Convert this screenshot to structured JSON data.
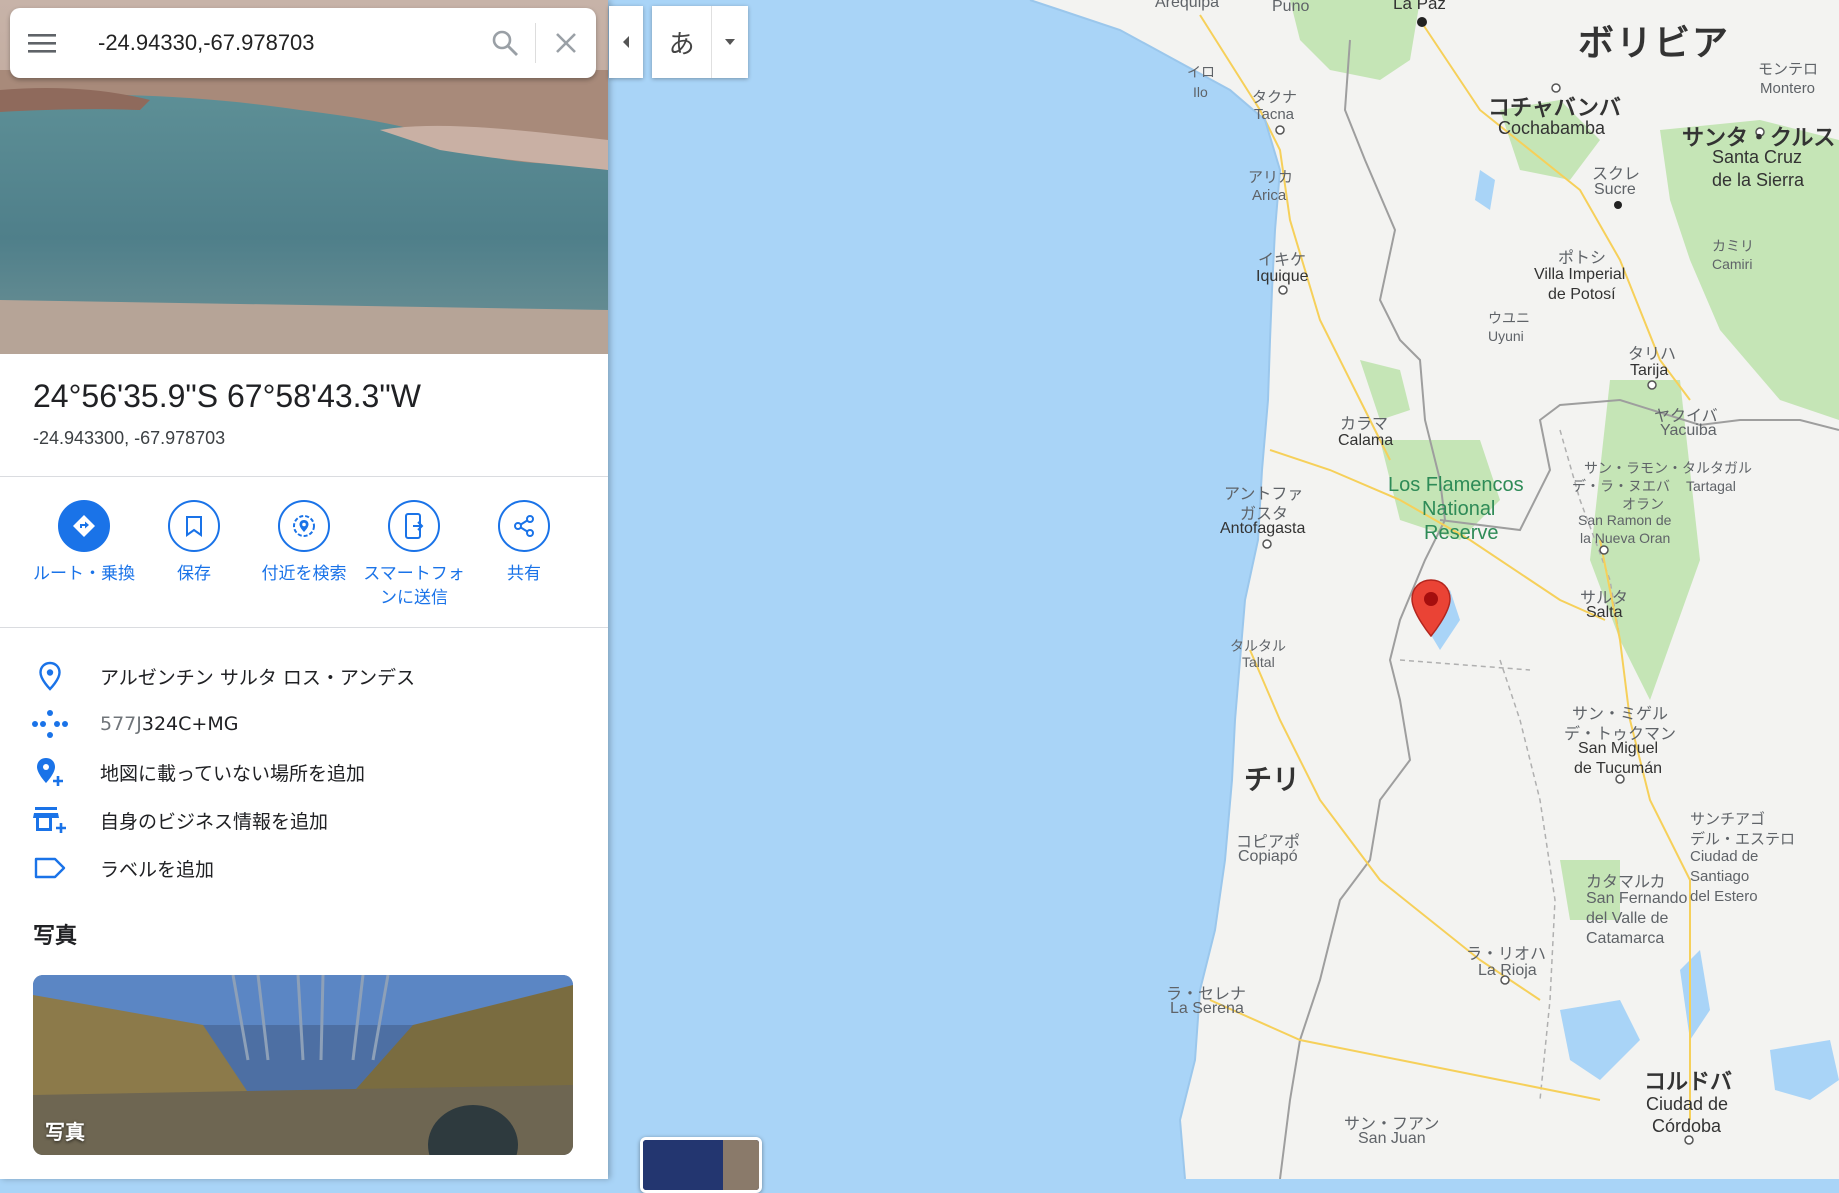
{
  "search": {
    "value": "-24.94330,-67.978703"
  },
  "place": {
    "title": "24°56'35.9\"S 67°58'43.3\"W",
    "decimal": "-24.943300, -67.978703"
  },
  "actions": [
    {
      "label": "ルート・乗換"
    },
    {
      "label": "保存"
    },
    {
      "label": "付近を検索"
    },
    {
      "label": "スマートフォンに送信"
    },
    {
      "label": "共有"
    }
  ],
  "info": {
    "address": "アルゼンチン サルタ ロス・アンデス",
    "pluscode_prefix": "577J",
    "pluscode_main": "324C+MG",
    "add_missing_place": "地図に載っていない場所を追加",
    "add_business": "自身のビジネス情報を追加",
    "add_label": "ラベルを追加"
  },
  "photos": {
    "title": "写真",
    "card_label": "写真"
  },
  "lang_button": {
    "char": "あ"
  },
  "colors": {
    "accent": "#1a73e8",
    "water": "#a9d4f7",
    "land": "#f3f3f1",
    "park": "#c5e5b6",
    "pin": "#ea4335"
  },
  "map_labels": {
    "arequipa": "Arequipa",
    "puno": "Puno",
    "lapaz": "La Paz",
    "bolivia": "ボリビア",
    "montero_jp": "モンテロ",
    "montero": "Montero",
    "ilo_jp": "イロ",
    "ilo": "Ilo",
    "tacna_jp": "タクナ",
    "tacna": "Tacna",
    "cocha_jp": "コチャバンバ",
    "cocha": "Cochabamba",
    "scruz_jp": "サンタ・クルス",
    "scruz1": "Santa Cruz",
    "scruz2": "de la Sierra",
    "arica_jp": "アリカ",
    "arica": "Arica",
    "sucre_jp": "スクレ",
    "sucre": "Sucre",
    "camiri_jp": "カミリ",
    "camiri": "Camiri",
    "iquique_jp": "イキケ",
    "iquique": "Iquique",
    "potosi_jp": "ポトシ",
    "potosi1": "Villa Imperial",
    "potosi2": "de Potosí",
    "uyuni_jp": "ウユニ",
    "uyuni": "Uyuni",
    "tarija_jp": "タリハ",
    "tarija": "Tarija",
    "yacuiba_jp": "ヤクイバ",
    "yacuiba": "Yacuiba",
    "calama_jp": "カラマ",
    "calama": "Calama",
    "flamencos1": "Los Flamencos",
    "flamencos2": "National",
    "flamencos3": "Reserve",
    "tartagal_jp": "サン・ラモン・タルタガル",
    "tartagal_jp2": "デ・ラ・ヌエバ",
    "tartagal_jp3": "オラン",
    "tartagal": "Tartagal",
    "sanramon1": "San Ramon de",
    "sanramon2": "la Nueva Oran",
    "antofa_jp1": "アントファ",
    "antofa_jp2": "ガスタ",
    "antofa": "Antofagasta",
    "salta_jp": "サルタ",
    "salta": "Salta",
    "taltal_jp": "タルタル",
    "taltal": "Taltal",
    "tucuman_jp1": "サン・ミゲル",
    "tucuman_jp2": "デ・トゥクマン",
    "tucuman1": "San Miguel",
    "tucuman2": "de Tucumán",
    "chile": "チリ",
    "copiapo_jp": "コピアポ",
    "copiapo": "Copiapó",
    "sde_jp1": "サンチアゴ",
    "sde_jp2": "デル・エステロ",
    "sde1": "Ciudad de",
    "sde2": "Santiago",
    "sde3": "del Estero",
    "catamarca_jp": "カタマルカ",
    "catamarca1": "San Fernando",
    "catamarca2": "del Valle de",
    "catamarca3": "Catamarca",
    "rioja_jp": "ラ・リオハ",
    "rioja": "La Rioja",
    "serena_jp": "ラ・セレナ",
    "serena": "La Serena",
    "cordoba_jp": "コルドバ",
    "cordoba1": "Ciudad de",
    "cordoba2": "Córdoba",
    "sanjuan_jp": "サン・フアン",
    "sanjuan": "San Juan"
  }
}
